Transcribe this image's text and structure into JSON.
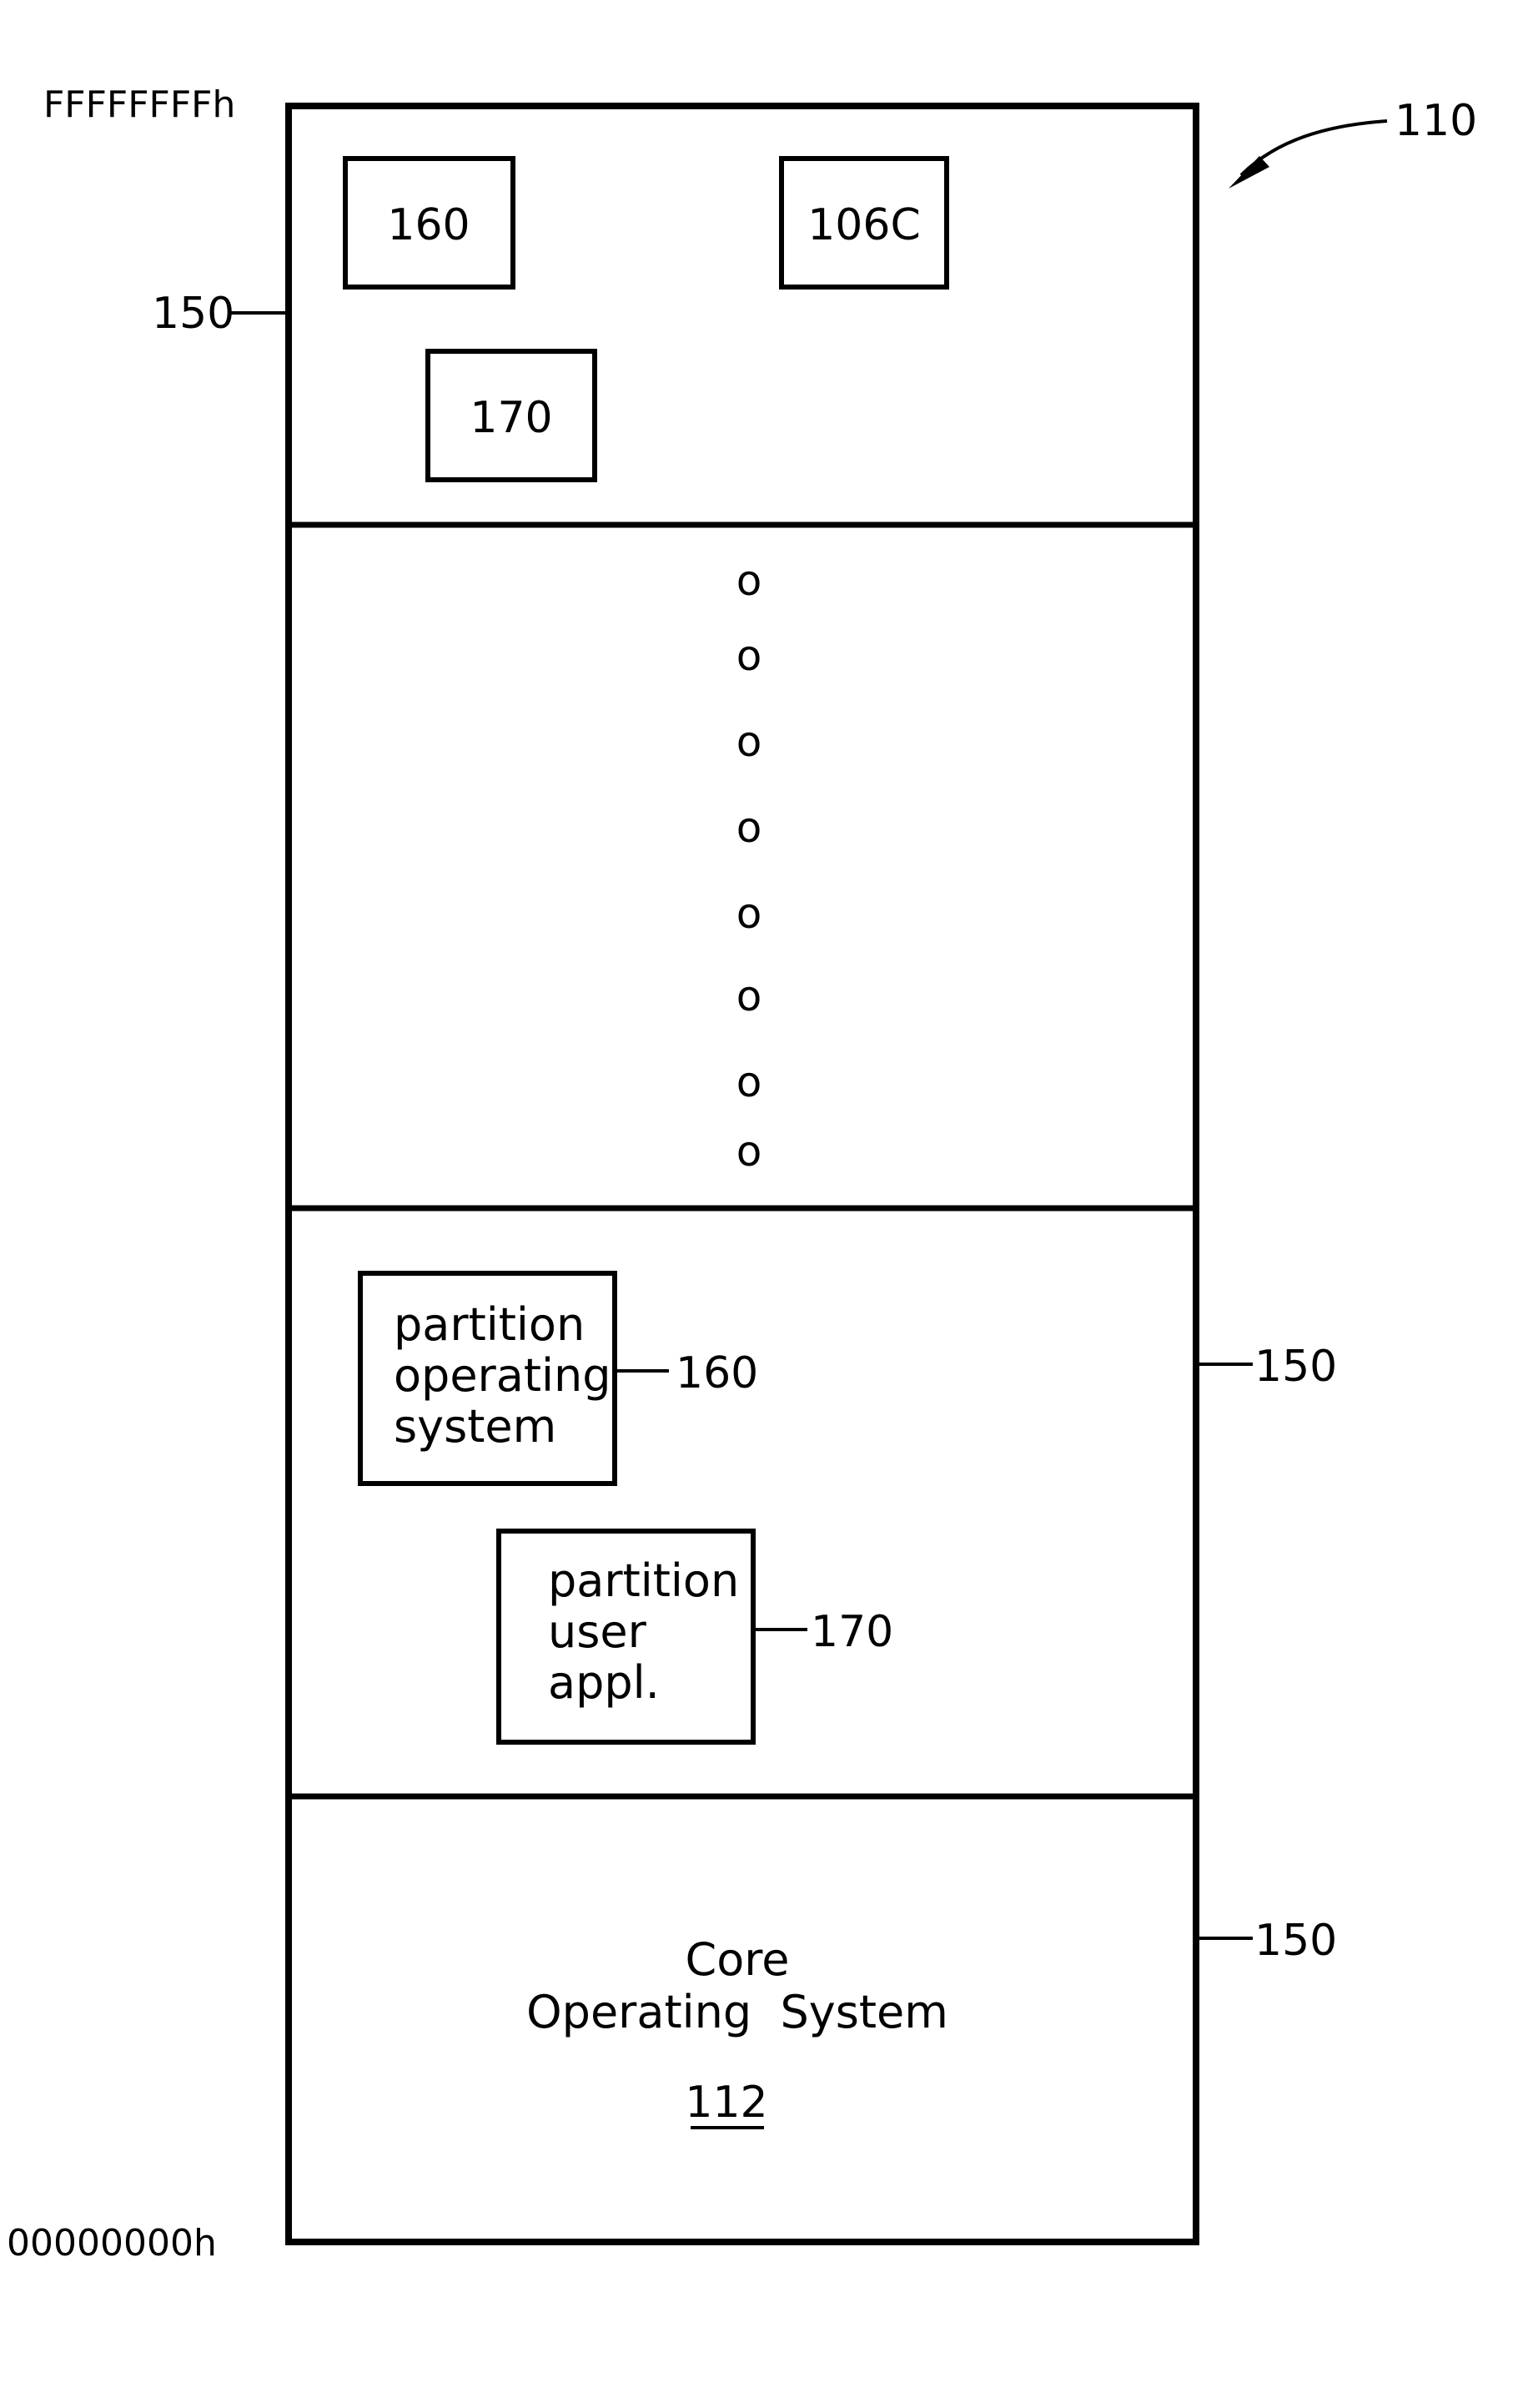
{
  "figure": {
    "reference": "110",
    "address_top": "FFFFFFFFh",
    "address_bottom": "00000000h"
  },
  "memory_map": {
    "partitions": [
      {
        "ref_label": "150",
        "label_side": "left",
        "items": [
          {
            "label": "160"
          },
          {
            "label": "106C"
          },
          {
            "label": "170"
          }
        ]
      },
      {
        "continuation_marks": [
          "o",
          "o",
          "o",
          "o",
          "o",
          "o",
          "o",
          "o"
        ]
      },
      {
        "ref_label": "150",
        "label_side": "right",
        "items": [
          {
            "lines": [
              "partition",
              "operating",
              "system"
            ],
            "ref": "160"
          },
          {
            "lines": [
              "partition",
              "user",
              "appl."
            ],
            "ref": "170"
          }
        ]
      },
      {
        "ref_label": "150",
        "label_side": "right",
        "title_lines": [
          "Core",
          "Operating  System"
        ],
        "ref_number": "112"
      }
    ]
  }
}
